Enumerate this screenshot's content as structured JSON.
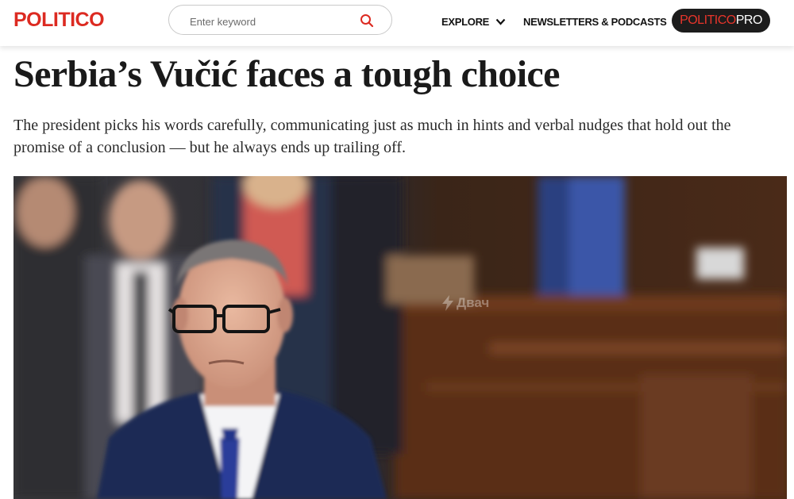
{
  "header": {
    "logo": "POLITICO",
    "search": {
      "placeholder": "Enter keyword",
      "value": ""
    },
    "nav": {
      "explore_label": "EXPLORE",
      "newsletters_label": "NEWSLETTERS & PODCASTS"
    },
    "pro": {
      "part1": "POLITICO",
      "part2": "PRO"
    }
  },
  "article": {
    "headline": "Serbia’s Vučić faces a tough choice",
    "dek": "The president picks his words carefully, communicating just as much in hints and verbal nudges that hold out the promise of a conclusion — but he always ends up trailing off."
  },
  "hero_image": {
    "watermark": "Двач"
  },
  "colors": {
    "brand_red": "#dc2a21",
    "pro_background": "#1c1c1c",
    "text": "#1a1a1a"
  },
  "icons": [
    "search-icon",
    "chevron-down-icon",
    "lightning-icon"
  ]
}
